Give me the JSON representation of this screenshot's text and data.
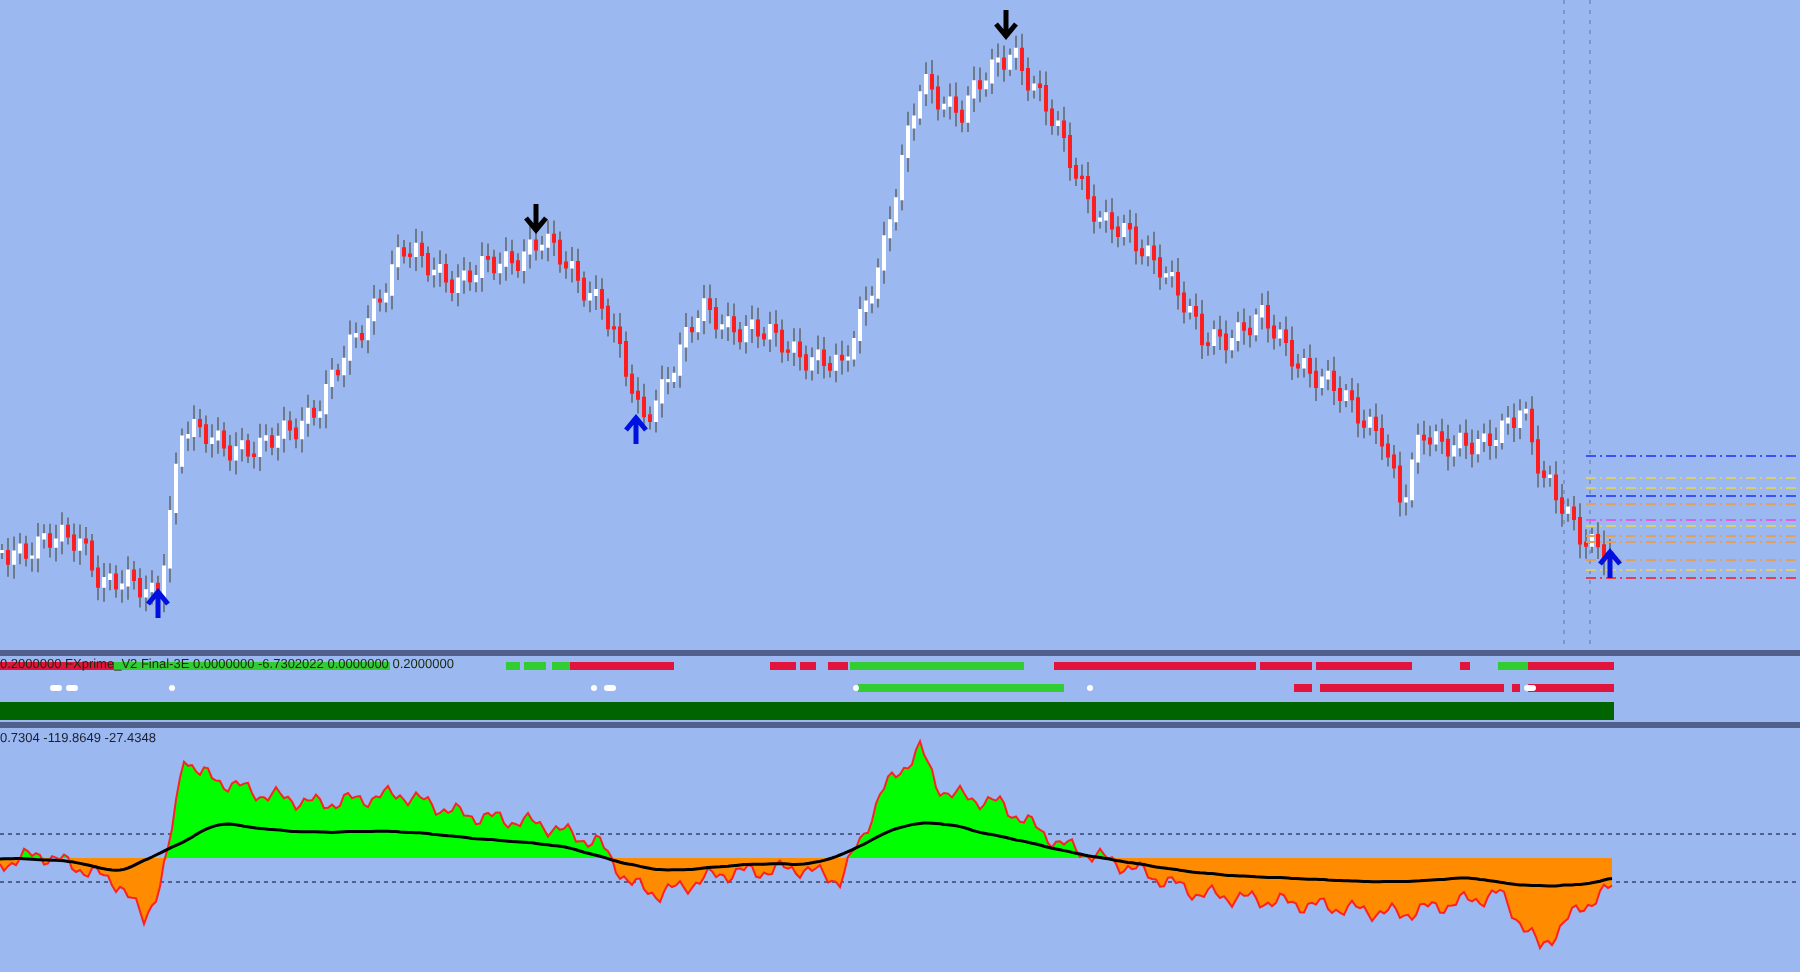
{
  "signal_panel": {
    "label": "0.2000000 FXprime_V2 Final-3E 0.0000000 -6.7302022 0.0000000 0.2000000"
  },
  "oscillator_panel": {
    "readout": "0.7304 -119.8649 -27.4348"
  }
}
